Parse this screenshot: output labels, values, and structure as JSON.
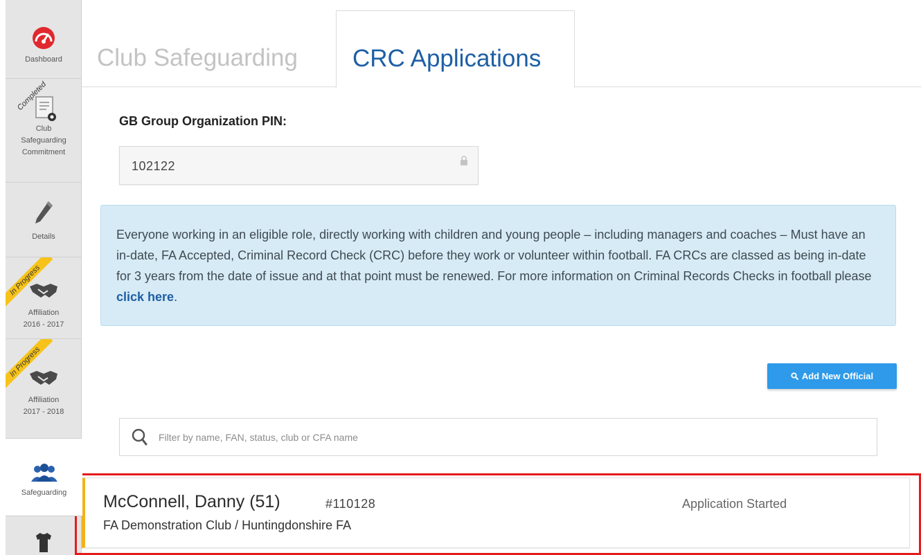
{
  "sidebar": {
    "items": [
      {
        "label": "Dashboard",
        "icon": "gauge-icon"
      },
      {
        "label": "Club Safeguarding Commitment",
        "label_lines": [
          "Club",
          "Safeguarding",
          "Commitment"
        ],
        "ribbon": "Completed",
        "icon": "document-ball-icon"
      },
      {
        "label": "Details",
        "icon": "pencil-icon"
      },
      {
        "label": "Affiliation 2016 - 2017",
        "label_lines": [
          "Affiliation",
          "2016 - 2017"
        ],
        "ribbon": "In Progress",
        "icon": "handshake-icon"
      },
      {
        "label": "Affiliation 2017 - 2018",
        "label_lines": [
          "Affiliation",
          "2017 - 2018"
        ],
        "ribbon": "In Progress",
        "icon": "handshake-icon"
      },
      {
        "label": "Safeguarding",
        "icon": "people-group-icon",
        "active": true
      },
      {
        "label": "",
        "icon": "shirt-icon"
      }
    ]
  },
  "tabs": [
    {
      "label": "Club Safeguarding",
      "active": false
    },
    {
      "label": "CRC Applications",
      "active": true
    }
  ],
  "pin": {
    "label": "GB Group Organization PIN:",
    "value": "102122"
  },
  "info": {
    "text": "Everyone working in an eligible role, directly working with children and young people – including managers and coaches – Must have an in-date, FA Accepted, Criminal Record Check (CRC) before they work or volunteer within football. FA CRCs are classed as being in-date for 3 years from the date of issue and at that point must be renewed. For more information on Criminal Records Checks in football please ",
    "link": "click here",
    "suffix": "."
  },
  "add_button": {
    "label": "Add New Official"
  },
  "filter": {
    "placeholder": "Filter by name, FAN, status, club or CFA name",
    "value": ""
  },
  "officials": [
    {
      "name": "McConnell, Danny (51)",
      "fan": "#110128",
      "status": "Application Started",
      "club": "FA Demonstration Club / Huntingdonshire FA"
    }
  ],
  "colors": {
    "accent_blue": "#1d5fa4",
    "button_blue": "#2e9ae9",
    "info_bg": "#d7ebf6",
    "ribbon_yellow": "#f7c31a",
    "status_bar": "#f2b21b",
    "highlight_red": "#e51a1a"
  }
}
